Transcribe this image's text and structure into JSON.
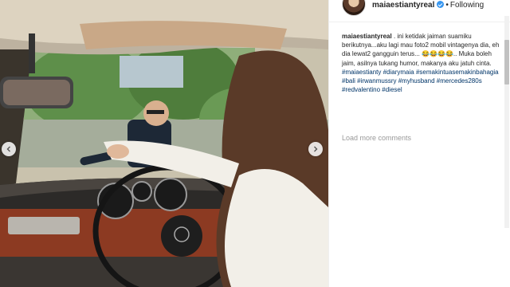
{
  "post": {
    "username": "maiaestiantyreal",
    "separator": "•",
    "follow_label": "Following",
    "caption_text": ". ini ketidak jaiman suamiku berikutnya...aku lagi mau foto2 mobil vintagenya dia, eh dia lewat2 gangguin terus... 😂😂😂😂.. Muka boleh jaim, asilnya tukang humor, makanya aku jatuh cinta.",
    "hashtags": [
      "#maiaestianty",
      "#diarymaia",
      "#semakintuasemakinbahagia",
      "#bali",
      "#irwanmussry",
      "#myhusband",
      "#mercedes280s",
      "#redvalentino",
      "#diesel"
    ],
    "load_more_label": "Load more comments"
  },
  "colors": {
    "hashtag": "#003569",
    "verified": "#3897f0",
    "muted": "#999999",
    "text": "#262626"
  },
  "icons": {
    "carousel_prev": "chevron-left-icon",
    "carousel_next": "chevron-right-icon",
    "verified": "verified-badge-icon"
  }
}
